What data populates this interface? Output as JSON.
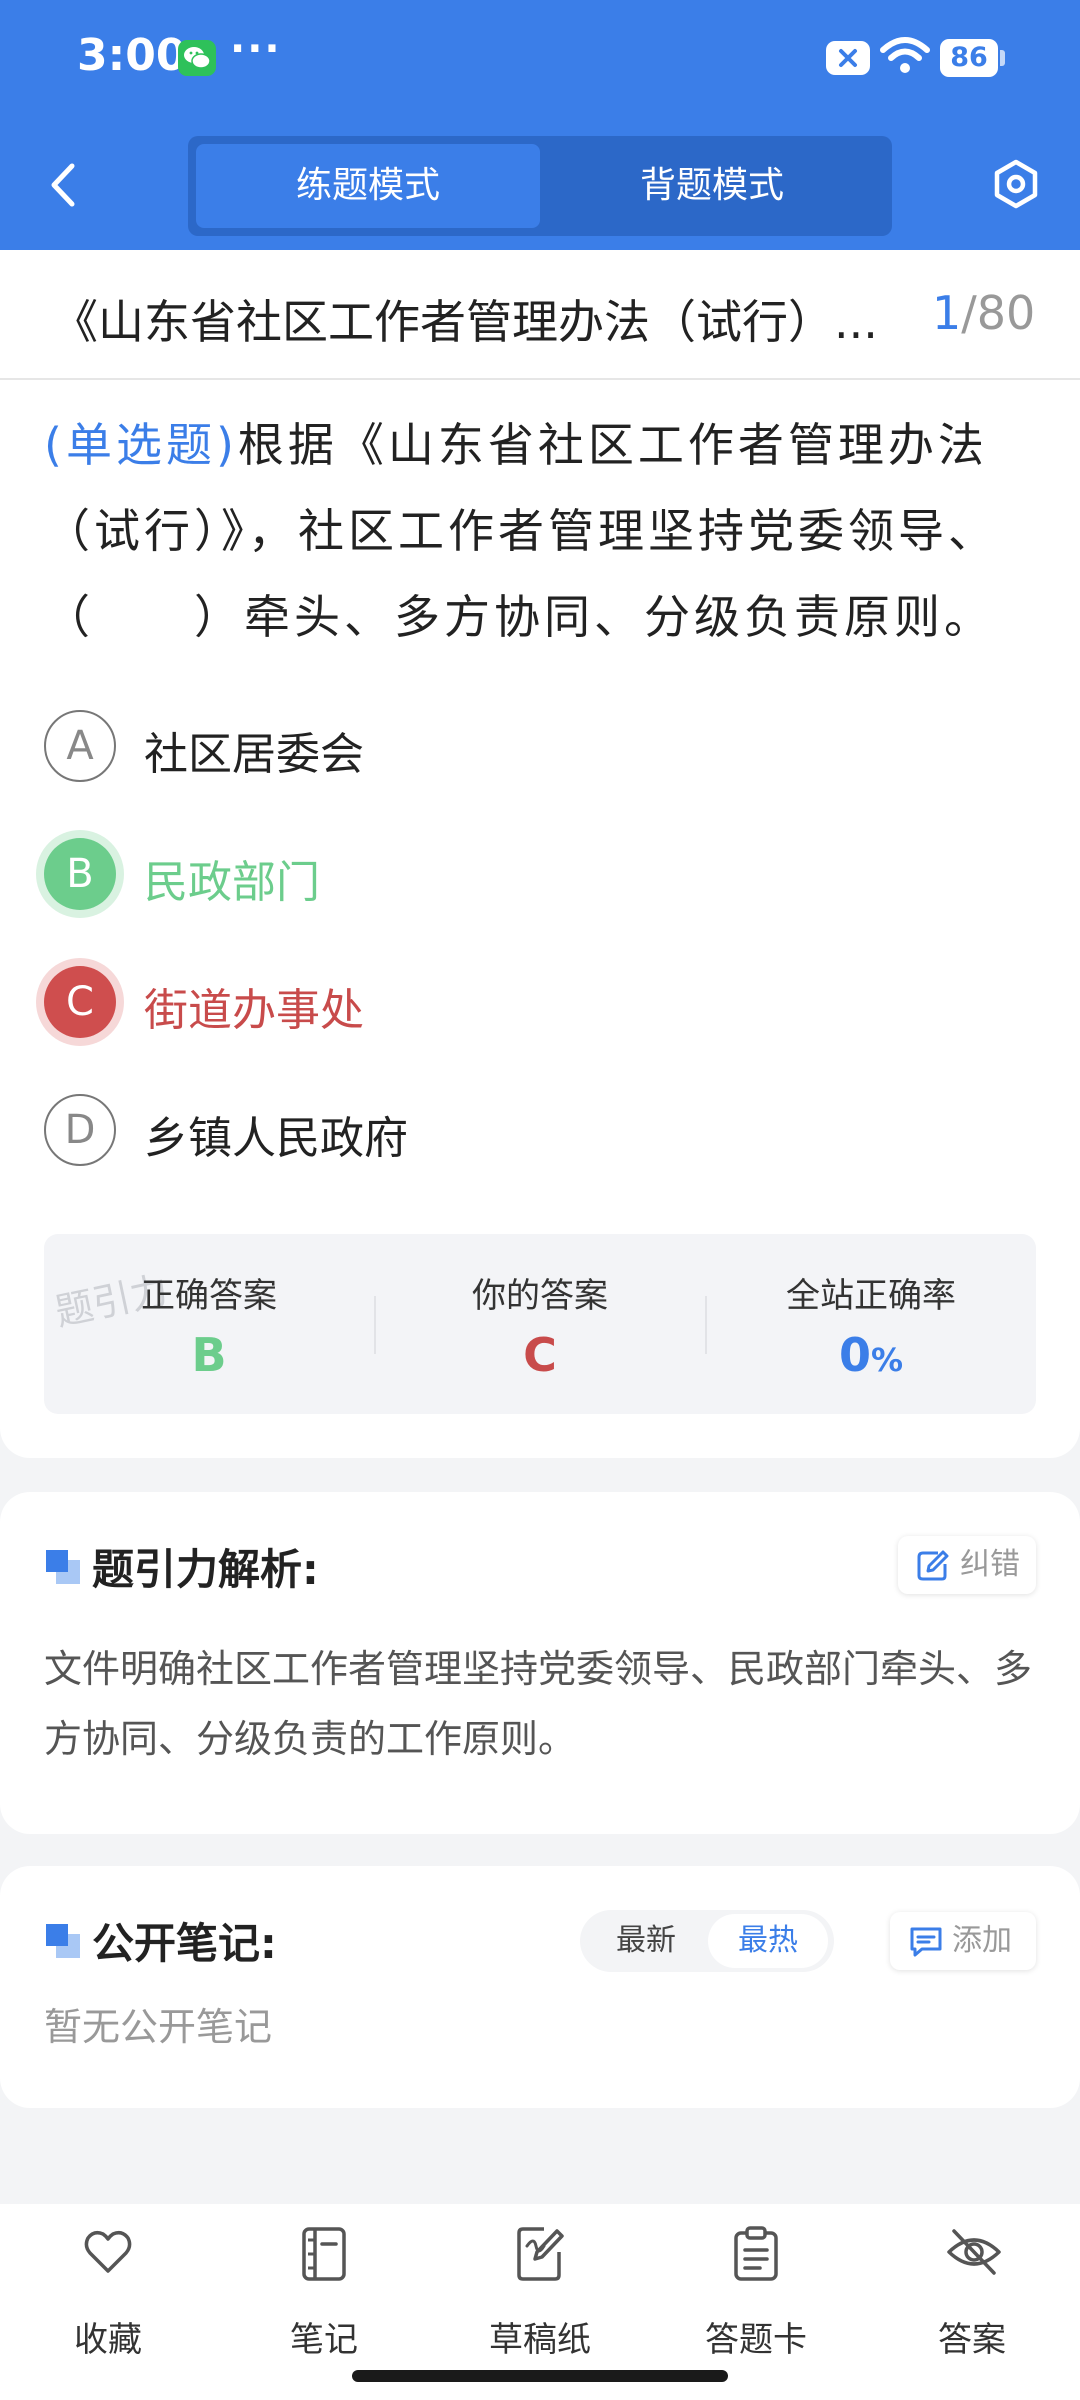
{
  "status_bar": {
    "time": "3:00",
    "more": "···",
    "battery": "86"
  },
  "header": {
    "tabs": [
      {
        "label": "练题模式",
        "active": true
      },
      {
        "label": "背题模式",
        "active": false
      }
    ]
  },
  "question": {
    "doc_title": "《山东省社区工作者管理办法（试行）...",
    "current": "1",
    "total": "/80",
    "type_label": "(单选题)",
    "text": "根据《山东省社区工作者管理办法（试行）》，社区工作者管理坚持党委领导、（　　）牵头、多方协同、分级负责原则。",
    "options": [
      {
        "letter": "A",
        "text": "社区居委会",
        "state": "normal"
      },
      {
        "letter": "B",
        "text": "民政部门",
        "state": "correct"
      },
      {
        "letter": "C",
        "text": "街道办事处",
        "state": "wrong"
      },
      {
        "letter": "D",
        "text": "乡镇人民政府",
        "state": "normal"
      }
    ],
    "watermark": "题引力",
    "result": {
      "correct_label": "正确答案",
      "correct_value": "B",
      "yours_label": "你的答案",
      "yours_value": "C",
      "rate_label": "全站正确率",
      "rate_value": "0",
      "rate_unit": "%"
    }
  },
  "analysis": {
    "title": "题引力解析:",
    "report_label": "纠错",
    "text": "文件明确社区工作者管理坚持党委领导、民政部门牵头、多方协同、分级负责的工作原则。"
  },
  "notes": {
    "title": "公开笔记:",
    "sort_latest": "最新",
    "sort_hot": "最热",
    "add_label": "添加",
    "empty_text": "暂无公开笔记"
  },
  "bottom_nav": [
    {
      "label": "收藏",
      "icon": "heart-icon"
    },
    {
      "label": "笔记",
      "icon": "notebook-icon"
    },
    {
      "label": "草稿纸",
      "icon": "draft-icon"
    },
    {
      "label": "答题卡",
      "icon": "answer-sheet-icon"
    },
    {
      "label": "答案",
      "icon": "eye-off-icon"
    }
  ],
  "colors": {
    "primary": "#3b7ee8",
    "correct": "#6ccd8c",
    "wrong": "#c84b4b"
  }
}
